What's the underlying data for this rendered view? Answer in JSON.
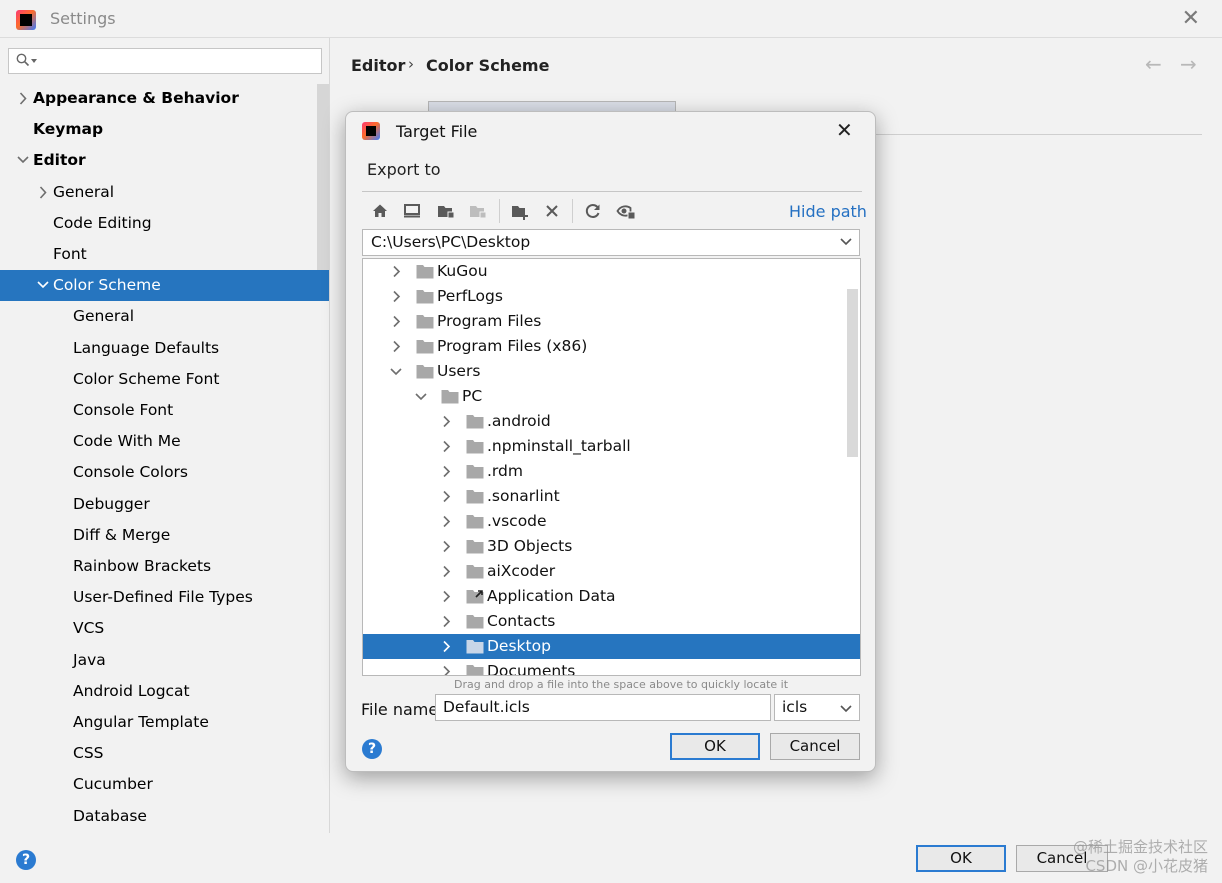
{
  "window": {
    "title": "Settings",
    "close_glyph": "✕"
  },
  "sidebar": {
    "search_placeholder": "",
    "items": [
      {
        "label": "Appearance & Behavior",
        "level": 0,
        "expander": "collapsed",
        "bold": true
      },
      {
        "label": "Keymap",
        "level": 0,
        "expander": "none",
        "bold": true
      },
      {
        "label": "Editor",
        "level": 0,
        "expander": "expanded",
        "bold": true
      },
      {
        "label": "General",
        "level": 1,
        "expander": "collapsed",
        "bold": false
      },
      {
        "label": "Code Editing",
        "level": 1,
        "expander": "none",
        "bold": false
      },
      {
        "label": "Font",
        "level": 1,
        "expander": "none",
        "bold": false
      },
      {
        "label": "Color Scheme",
        "level": 1,
        "expander": "expanded",
        "bold": false,
        "selected": true
      },
      {
        "label": "General",
        "level": 2,
        "expander": "none",
        "bold": false
      },
      {
        "label": "Language Defaults",
        "level": 2,
        "expander": "none",
        "bold": false
      },
      {
        "label": "Color Scheme Font",
        "level": 2,
        "expander": "none",
        "bold": false
      },
      {
        "label": "Console Font",
        "level": 2,
        "expander": "none",
        "bold": false
      },
      {
        "label": "Code With Me",
        "level": 2,
        "expander": "none",
        "bold": false
      },
      {
        "label": "Console Colors",
        "level": 2,
        "expander": "none",
        "bold": false
      },
      {
        "label": "Debugger",
        "level": 2,
        "expander": "none",
        "bold": false
      },
      {
        "label": "Diff & Merge",
        "level": 2,
        "expander": "none",
        "bold": false
      },
      {
        "label": "Rainbow Brackets",
        "level": 2,
        "expander": "none",
        "bold": false
      },
      {
        "label": "User-Defined File Types",
        "level": 2,
        "expander": "none",
        "bold": false
      },
      {
        "label": "VCS",
        "level": 2,
        "expander": "none",
        "bold": false
      },
      {
        "label": "Java",
        "level": 2,
        "expander": "none",
        "bold": false
      },
      {
        "label": "Android Logcat",
        "level": 2,
        "expander": "none",
        "bold": false
      },
      {
        "label": "Angular Template",
        "level": 2,
        "expander": "none",
        "bold": false
      },
      {
        "label": "CSS",
        "level": 2,
        "expander": "none",
        "bold": false
      },
      {
        "label": "Cucumber",
        "level": 2,
        "expander": "none",
        "bold": false
      },
      {
        "label": "Database",
        "level": 2,
        "expander": "none",
        "bold": false
      }
    ]
  },
  "breadcrumb": {
    "part1": "Editor",
    "separator": "›",
    "part2": "Color Scheme"
  },
  "nav": {
    "back": "←",
    "forward": "→"
  },
  "footer": {
    "help": "?",
    "ok_label": "OK",
    "cancel_label": "Cancel"
  },
  "watermark": {
    "line1": "@稀土掘金技术社区",
    "line2": "CSDN @小花皮猪"
  },
  "dialog": {
    "title": "Target File",
    "close_glyph": "✕",
    "subtitle": "Export to",
    "hide_path_label": "Hide path",
    "path_value": "C:\\Users\\PC\\Desktop",
    "tree": [
      {
        "label": "KuGou",
        "level": 0,
        "expander": "collapsed"
      },
      {
        "label": "PerfLogs",
        "level": 0,
        "expander": "collapsed"
      },
      {
        "label": "Program Files",
        "level": 0,
        "expander": "collapsed"
      },
      {
        "label": "Program Files (x86)",
        "level": 0,
        "expander": "collapsed"
      },
      {
        "label": "Users",
        "level": 0,
        "expander": "expanded"
      },
      {
        "label": "PC",
        "level": 1,
        "expander": "expanded"
      },
      {
        "label": ".android",
        "level": 2,
        "expander": "collapsed"
      },
      {
        "label": ".npminstall_tarball",
        "level": 2,
        "expander": "collapsed"
      },
      {
        "label": ".rdm",
        "level": 2,
        "expander": "collapsed"
      },
      {
        "label": ".sonarlint",
        "level": 2,
        "expander": "collapsed"
      },
      {
        "label": ".vscode",
        "level": 2,
        "expander": "collapsed"
      },
      {
        "label": "3D Objects",
        "level": 2,
        "expander": "collapsed"
      },
      {
        "label": "aiXcoder",
        "level": 2,
        "expander": "collapsed"
      },
      {
        "label": "Application Data",
        "level": 2,
        "expander": "collapsed",
        "shortcut": true
      },
      {
        "label": "Contacts",
        "level": 2,
        "expander": "collapsed"
      },
      {
        "label": "Desktop",
        "level": 2,
        "expander": "collapsed",
        "selected": true
      },
      {
        "label": "Documents",
        "level": 2,
        "expander": "collapsed"
      }
    ],
    "drag_hint": "Drag and drop a file into the space above to quickly locate it",
    "file_name_label": "File name:",
    "file_name_value": "Default.icls",
    "extension_value": "icls",
    "help": "?",
    "ok_label": "OK",
    "cancel_label": "Cancel"
  },
  "colors": {
    "selection": "#2675bf",
    "link": "#2470c2",
    "accent": "#2b7bd1"
  }
}
